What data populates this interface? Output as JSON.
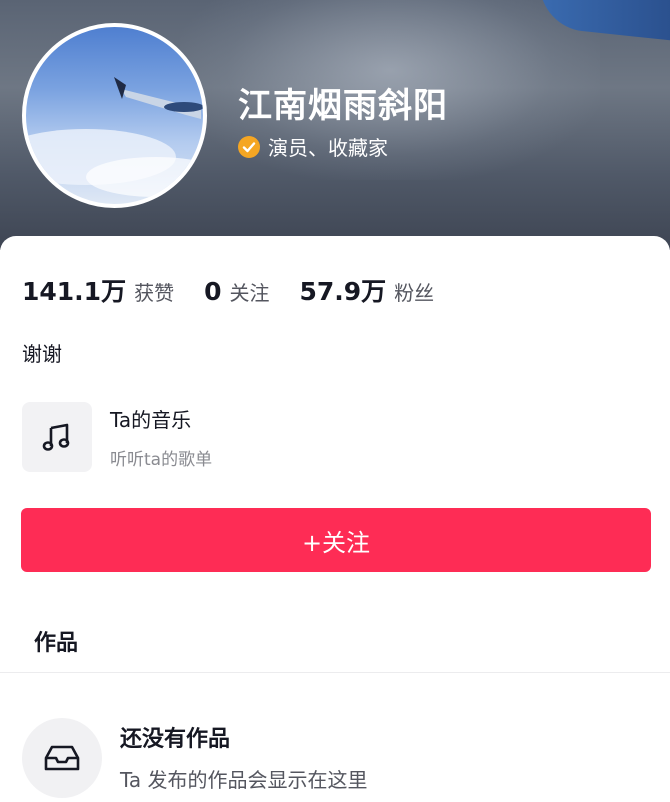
{
  "profile": {
    "nickname": "江南烟雨斜阳",
    "verified_label": "演员、收藏家",
    "bio": "谢谢"
  },
  "stats": [
    {
      "value": "141.1万",
      "label": "获赞"
    },
    {
      "value": "0",
      "label": "关注"
    },
    {
      "value": "57.9万",
      "label": "粉丝"
    }
  ],
  "music": {
    "title": "Ta的音乐",
    "subtitle": "听听ta的歌单",
    "icon": "music-note-icon"
  },
  "actions": {
    "follow_label": "+关注"
  },
  "works": {
    "section_title": "作品",
    "empty_title": "还没有作品",
    "empty_subtitle": "Ta 发布的作品会显示在这里",
    "empty_icon": "inbox-tray-icon"
  },
  "colors": {
    "accent": "#fe2c55",
    "verified": "#f5a623"
  }
}
